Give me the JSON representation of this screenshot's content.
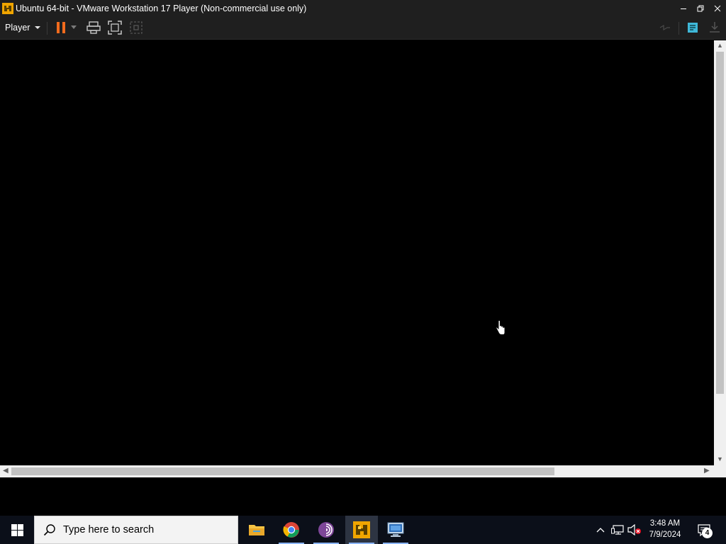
{
  "window": {
    "title": "Ubuntu 64-bit - VMware Workstation 17 Player (Non-commercial use only)",
    "app_icon": "vmware-icon",
    "controls": [
      "minimize-icon",
      "restore-icon",
      "close-icon"
    ]
  },
  "toolbar": {
    "player_label": "Player",
    "icons": [
      "pause-icon",
      "pause-dropdown-icon",
      "send-ctrl-alt-del-icon",
      "fullscreen-icon",
      "unity-icon",
      "removable-devices-icon",
      "message-log-icon",
      "download-icon"
    ]
  },
  "console": {
    "background": "#000000",
    "cursor": "hand-cursor-icon"
  },
  "taskbar": {
    "search_placeholder": "Type here to search",
    "apps": [
      "file-explorer-icon",
      "chrome-icon",
      "tor-browser-icon",
      "vmware-player-icon",
      "remote-desktop-icon"
    ],
    "active_app": "vmware-player-icon",
    "tray_icons": [
      "show-hidden-icons-icon",
      "network-icon",
      "volume-muted-icon"
    ],
    "time": "3:48 AM",
    "date": "7/9/2024",
    "notification_count": "4"
  },
  "colors": {
    "titlebar_bg": "#1f1f1f",
    "taskbar_bg": "#0b0f19",
    "pause_accent": "#f26b1d",
    "message_log_accent": "#3fb8d8"
  }
}
